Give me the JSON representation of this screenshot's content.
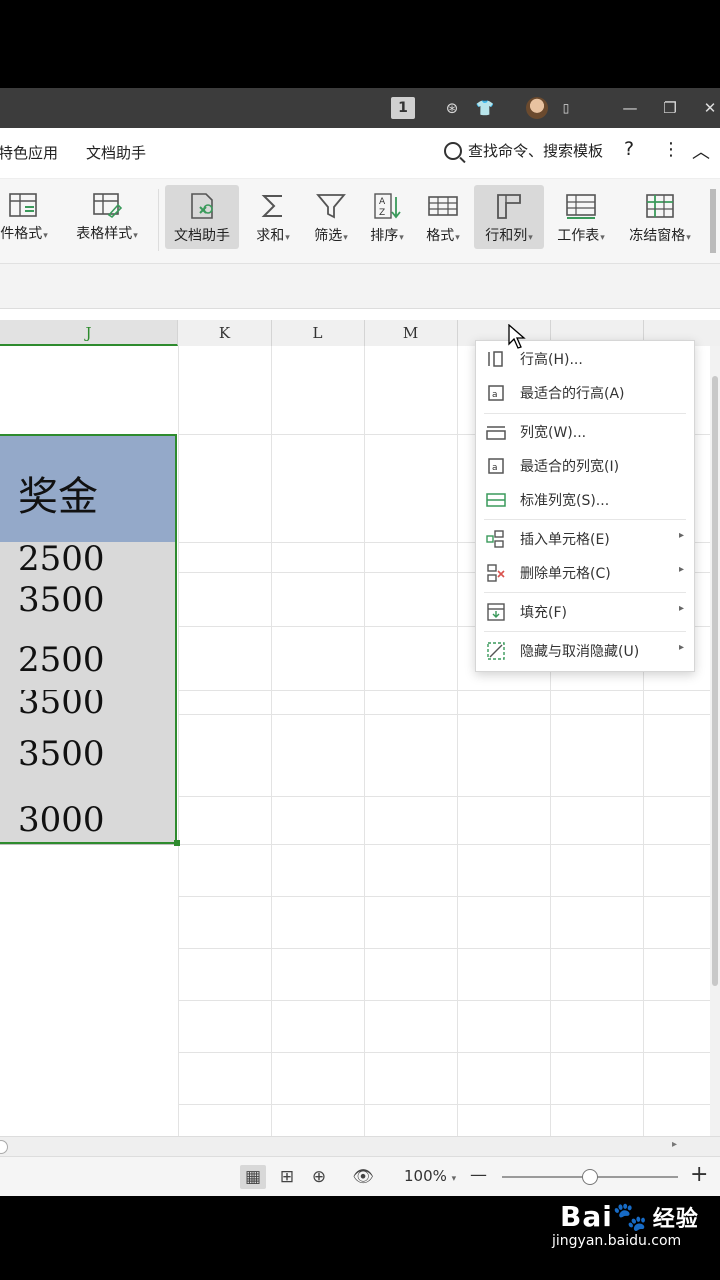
{
  "titlebar": {
    "badge": "1"
  },
  "menu": {
    "partial_tab": "特色应用",
    "doc_assistant_tab": "文档助手",
    "search_placeholder": "查找命令、搜索模板",
    "help": "?",
    "more": "⋮",
    "collapse": "︿"
  },
  "ribbon": {
    "conditional_format": "件格式",
    "table_style": "表格样式",
    "doc_assistant": "文档助手",
    "sum": "求和",
    "filter": "筛选",
    "sort": "排序",
    "format": "格式",
    "row_col": "行和列",
    "worksheet": "工作表",
    "freeze": "冻结窗格"
  },
  "columns": [
    "J",
    "K",
    "L",
    "M"
  ],
  "table": {
    "header": "奖金",
    "values": [
      "2500",
      "3500",
      "2500",
      "3500",
      "3500",
      "3000"
    ]
  },
  "dropdown": {
    "row_height": "行高(H)...",
    "best_row_height": "最适合的行高(A)",
    "col_width": "列宽(W)...",
    "best_col_width": "最适合的列宽(I)",
    "std_col_width": "标准列宽(S)...",
    "insert_cells": "插入单元格(E)",
    "delete_cells": "删除单元格(C)",
    "fill": "填充(F)",
    "hide_unhide": "隐藏与取消隐藏(U)"
  },
  "status": {
    "zoom": "100%",
    "zoom_level_percent": 100,
    "minus": "—",
    "plus": "+"
  },
  "watermark": {
    "brand": "Bai",
    "brand_cn": "经验",
    "url": "jingyan.baidu.com"
  },
  "colors": {
    "header_fill": "#94a9c9",
    "cell_fill": "#d9d9d9",
    "selection": "#2e8b2e",
    "title_bg": "#3c3c3c"
  }
}
